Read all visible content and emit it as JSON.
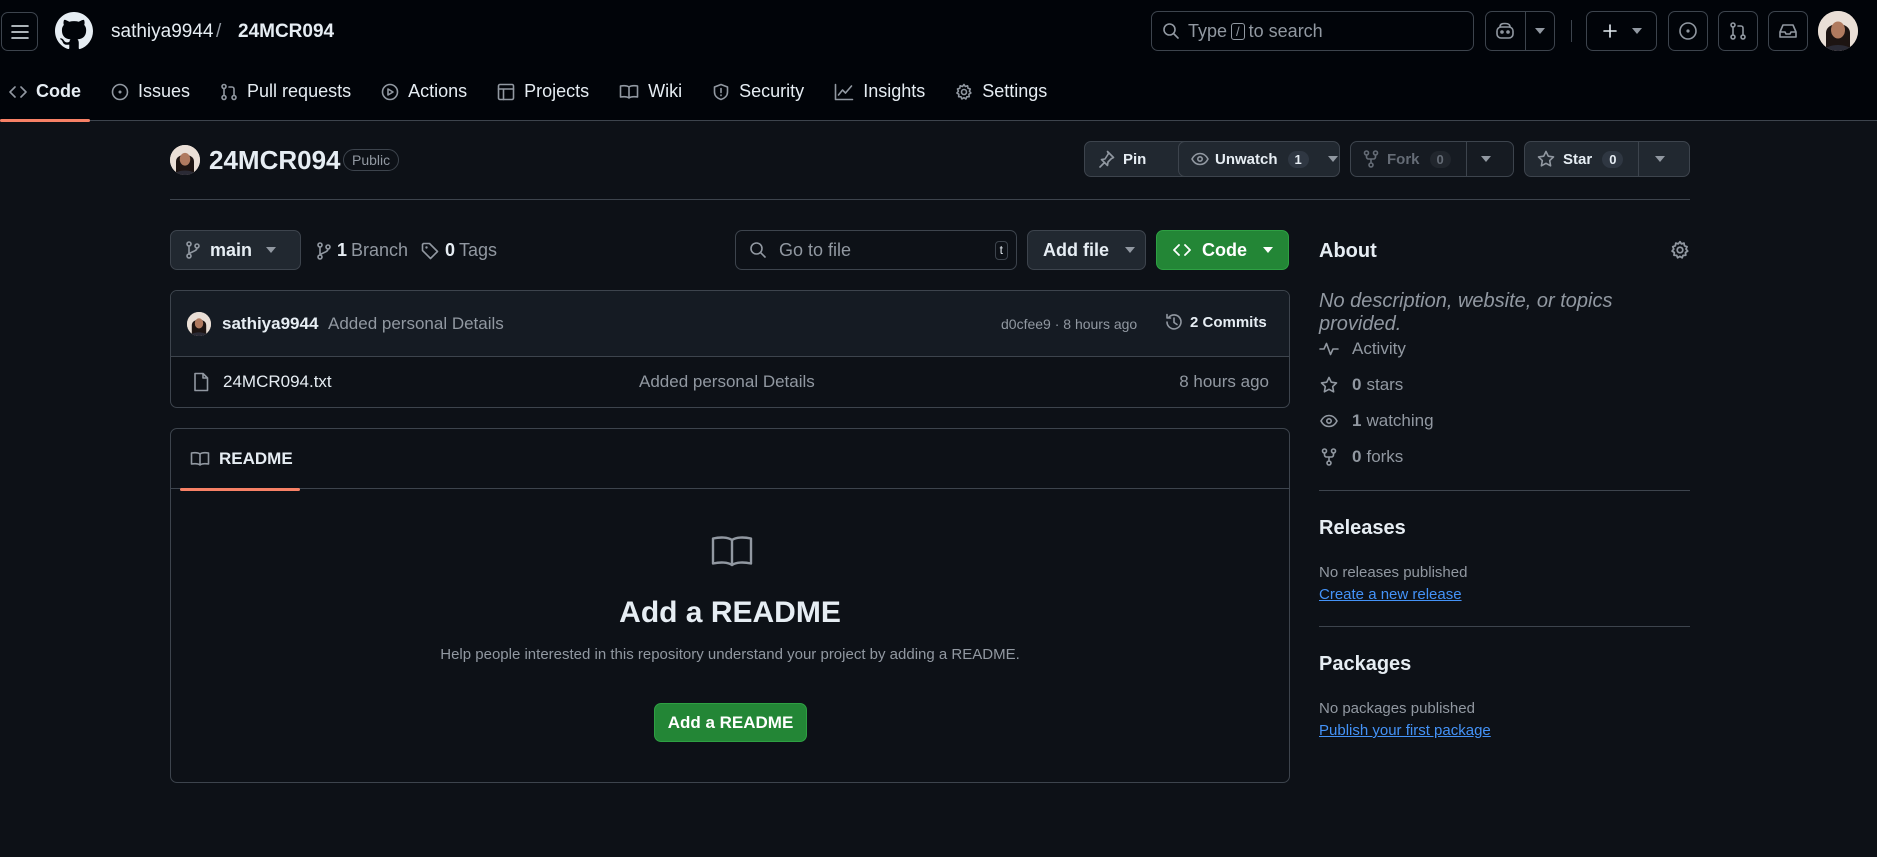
{
  "header": {
    "owner": "sathiya9944",
    "separator": "/",
    "repo": "24MCR094",
    "search_prefix": "Type",
    "search_key": "/",
    "search_suffix": "to search"
  },
  "tabs": [
    {
      "label": "Code",
      "icon": "code-icon",
      "active": true
    },
    {
      "label": "Issues",
      "icon": "issue-icon"
    },
    {
      "label": "Pull requests",
      "icon": "pull-request-icon"
    },
    {
      "label": "Actions",
      "icon": "play-icon"
    },
    {
      "label": "Projects",
      "icon": "table-icon"
    },
    {
      "label": "Wiki",
      "icon": "book-icon"
    },
    {
      "label": "Security",
      "icon": "shield-icon"
    },
    {
      "label": "Insights",
      "icon": "graph-icon"
    },
    {
      "label": "Settings",
      "icon": "gear-icon"
    }
  ],
  "repo": {
    "name": "24MCR094",
    "visibility": "Public",
    "pin_label": "Pin",
    "unwatch_label": "Unwatch",
    "watch_count": "1",
    "fork_label": "Fork",
    "fork_count": "0",
    "star_label": "Star",
    "star_count": "0"
  },
  "controls": {
    "branch": "main",
    "branch_count": "1",
    "branch_label": "Branch",
    "tag_count": "0",
    "tag_label": "Tags",
    "goto_placeholder": "Go to file",
    "goto_key": "t",
    "add_file_label": "Add file",
    "code_label": "Code"
  },
  "commit": {
    "author": "sathiya9944",
    "message": "Added personal Details",
    "meta": "d0cfee9 · 8 hours ago",
    "commits_label": "2 Commits"
  },
  "files": [
    {
      "name": "24MCR094.txt",
      "message": "Added personal Details",
      "time": "8 hours ago"
    }
  ],
  "readme": {
    "tab_label": "README",
    "title": "Add a README",
    "subtitle": "Help people interested in this repository understand your project by adding a README.",
    "button_label": "Add a README"
  },
  "about": {
    "title": "About",
    "description": "No description, website, or topics provided.",
    "activity_label": "Activity",
    "stars_count": "0",
    "stars_label": "stars",
    "watching_count": "1",
    "watching_label": "watching",
    "forks_count": "0",
    "forks_label": "forks"
  },
  "releases": {
    "title": "Releases",
    "empty_text": "No releases published",
    "link_label": "Create a new release"
  },
  "packages": {
    "title": "Packages",
    "empty_text": "No packages published",
    "link_label": "Publish your first package"
  },
  "colors": {
    "background": "#0d1117",
    "header_bg": "#010409",
    "accent_green": "#238636",
    "tab_underline": "#f78166",
    "link_blue": "#4493f8"
  }
}
